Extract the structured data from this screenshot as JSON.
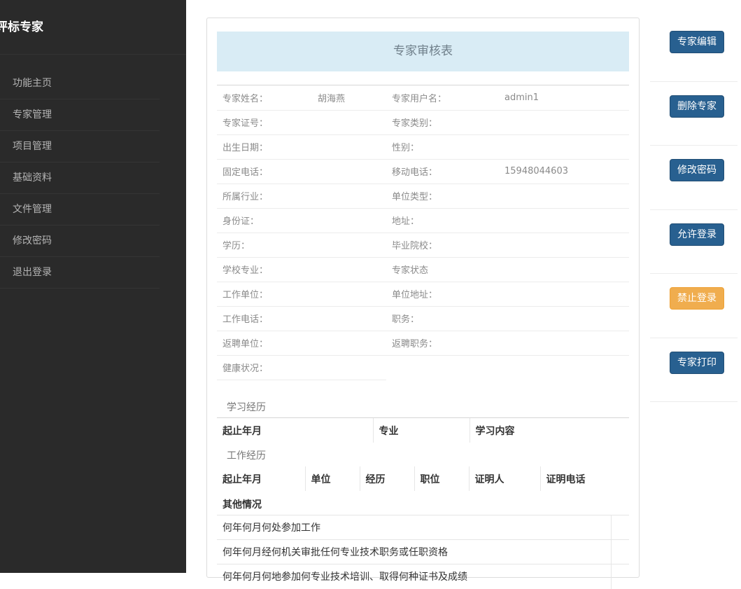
{
  "sidebar": {
    "brand": "评标专家",
    "items": [
      {
        "label": "功能主页"
      },
      {
        "label": "专家管理"
      },
      {
        "label": "项目管理"
      },
      {
        "label": "基础资料"
      },
      {
        "label": "文件管理"
      },
      {
        "label": "修改密码"
      },
      {
        "label": "退出登录"
      }
    ]
  },
  "form": {
    "title": "专家审核表",
    "rows": [
      {
        "l1": "专家姓名：",
        "v1": "胡海燕",
        "l2": "专家用户名：",
        "v2": "admin1"
      },
      {
        "l1": "专家证号：",
        "v1": "",
        "l2": "专家类别：",
        "v2": ""
      },
      {
        "l1": "出生日期：",
        "v1": "",
        "l2": "性别：",
        "v2": ""
      },
      {
        "l1": "固定电话：",
        "v1": "",
        "l2": "移动电话：",
        "v2": "15948044603"
      },
      {
        "l1": "所属行业：",
        "v1": "",
        "l2": "单位类型：",
        "v2": ""
      },
      {
        "l1": "身份证：",
        "v1": "",
        "l2": "地址：",
        "v2": ""
      },
      {
        "l1": "学历：",
        "v1": "",
        "l2": "毕业院校：",
        "v2": ""
      },
      {
        "l1": "学校专业：",
        "v1": "",
        "l2": "专家状态",
        "v2": ""
      },
      {
        "l1": "工作单位：",
        "v1": "",
        "l2": "单位地址：",
        "v2": ""
      },
      {
        "l1": "工作电话：",
        "v1": "",
        "l2": "职务：",
        "v2": ""
      },
      {
        "l1": "返聘单位：",
        "v1": "",
        "l2": "返聘职务：",
        "v2": ""
      },
      {
        "l1": "健康状况：",
        "v1": "",
        "l2": "",
        "v2": ""
      }
    ],
    "study": {
      "title": "学习经历",
      "headers": [
        "起止年月",
        "专业",
        "学习内容"
      ]
    },
    "work": {
      "title": "工作经历",
      "headers": [
        "起止年月",
        "单位",
        "经历",
        "职位",
        "证明人",
        "证明电话"
      ]
    },
    "other": {
      "title": "其他情况",
      "rows": [
        "何年何月何处参加工作",
        "何年何月经何机关审批任何专业技术职务或任职资格",
        "何年何月何地参加何专业技术培训、取得何种证书及成绩"
      ]
    }
  },
  "actions": [
    {
      "label": "专家编辑",
      "style": "primary"
    },
    {
      "label": "删除专家",
      "style": "primary"
    },
    {
      "label": "修改密码",
      "style": "primary"
    },
    {
      "label": "允许登录",
      "style": "primary"
    },
    {
      "label": "禁止登录",
      "style": "warning"
    },
    {
      "label": "专家打印",
      "style": "primary"
    }
  ],
  "colors": {
    "sidebar_bg": "#2a2a2a",
    "primary": "#286090",
    "warning": "#f0ad4e",
    "title_bar_bg": "#d9ecf5"
  }
}
